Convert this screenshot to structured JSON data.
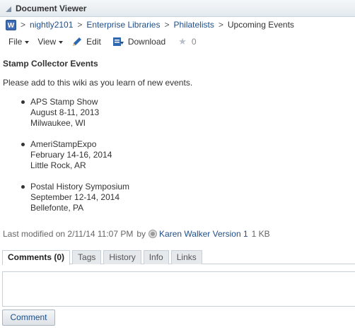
{
  "panel": {
    "title": "Document Viewer"
  },
  "breadcrumb": {
    "app_icon_letter": "W",
    "items": [
      "nightly2101",
      "Enterprise Libraries",
      "Philatelists"
    ],
    "current": "Upcoming Events"
  },
  "toolbar": {
    "file_label": "File",
    "view_label": "View",
    "edit_label": "Edit",
    "download_label": "Download",
    "rating_count": "0"
  },
  "document": {
    "title": "Stamp Collector Events",
    "intro": "Please add to this wiki as you learn of new events.",
    "events": [
      {
        "name": "APS Stamp Show",
        "dates": "August 8-11, 2013",
        "location": "Milwaukee, WI"
      },
      {
        "name": "AmeriStampExpo",
        "dates": "February 14-16, 2014",
        "location": "Little Rock, AR"
      },
      {
        "name": "Postal History Symposium",
        "dates": "September 12-14, 2014",
        "location": "Bellefonte, PA"
      }
    ]
  },
  "meta": {
    "modified_text": "Last modified on 2/11/14 11:07 PM",
    "by_label": "by",
    "author_version": "Karen Walker Version 1",
    "size": "1 KB"
  },
  "tabs": [
    {
      "label": "Comments (0)",
      "active": true
    },
    {
      "label": "Tags",
      "active": false
    },
    {
      "label": "History",
      "active": false
    },
    {
      "label": "Info",
      "active": false
    },
    {
      "label": "Links",
      "active": false
    }
  ],
  "comment_button_label": "Comment"
}
